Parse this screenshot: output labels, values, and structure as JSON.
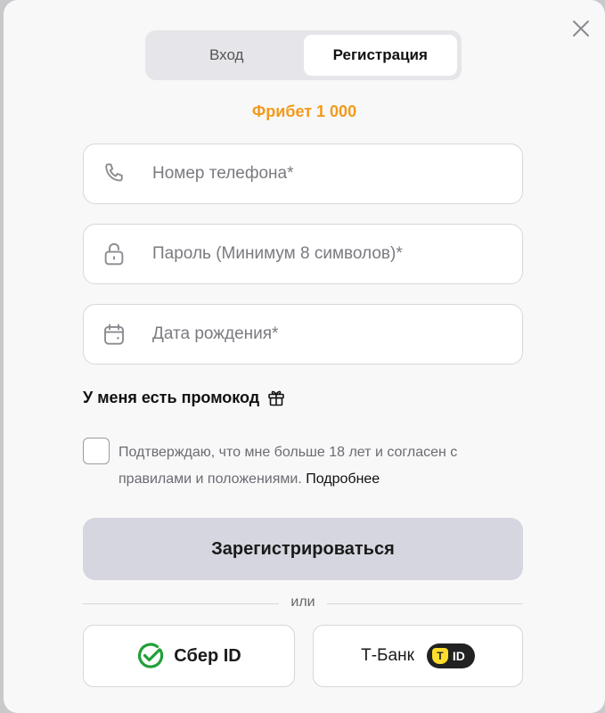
{
  "tabs": [
    {
      "label": "Вход",
      "active": false
    },
    {
      "label": "Регистрация",
      "active": true
    }
  ],
  "freebet": "Фрибет 1 000",
  "fields": {
    "phone": {
      "placeholder": "Номер телефона*",
      "value": "",
      "icon": "phone-icon"
    },
    "password": {
      "placeholder": "Пароль (Минимум 8 символов)*",
      "value": "",
      "icon": "lock-icon"
    },
    "birthdate": {
      "placeholder": "Дата рождения*",
      "value": "",
      "icon": "calendar-icon"
    }
  },
  "promo": {
    "label": "У меня есть промокод",
    "icon": "gift-icon"
  },
  "consent": {
    "checked": false,
    "text": "Подтверждаю, что мне больше 18 лет и согласен с правилами и положениями.",
    "more_link": "Подробнее"
  },
  "submit_label": "Зарегистрироваться",
  "divider_text": "или",
  "external": {
    "sber": {
      "label": "Сбер ID",
      "icon": "sber-check-icon",
      "color": "#21a038"
    },
    "tbank": {
      "label": "Т-Банк",
      "badge_letter": "T",
      "badge_text": "ID",
      "badge_color": "#ffdd2d"
    }
  },
  "colors": {
    "accent": "#f39a1a",
    "submit_bg": "#d5d6df"
  }
}
